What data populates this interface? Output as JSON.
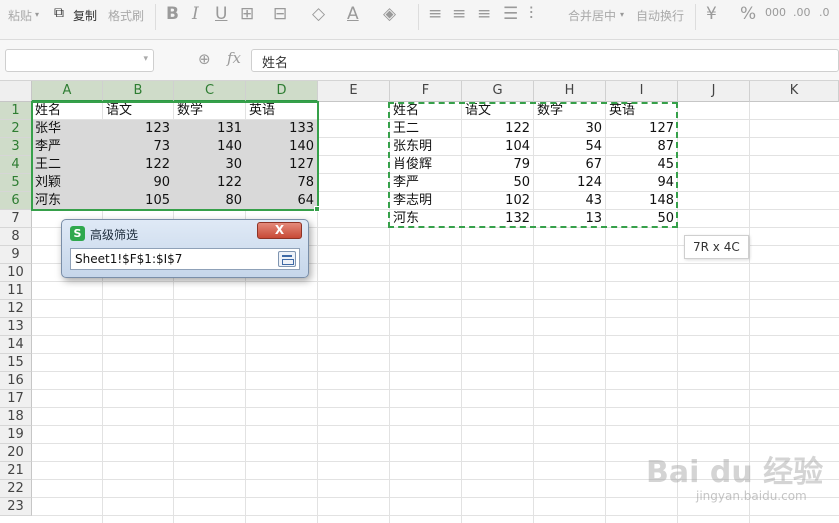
{
  "toolbar": {
    "paste_label": "粘贴",
    "copy_label": "复制",
    "format_painter_label": "格式刷",
    "bold_label": "B",
    "italic_label": "I",
    "underline_label": "U",
    "merge_center_label": "合并居中",
    "wrap_text_label": "自动换行",
    "percent_label": "%"
  },
  "formula_bar": {
    "fx_label": "fx",
    "content": "姓名"
  },
  "grid": {
    "columns": [
      "A",
      "B",
      "C",
      "D",
      "E",
      "F",
      "G",
      "H",
      "I",
      "J",
      "K"
    ],
    "rows": [
      "1",
      "2",
      "3",
      "4",
      "5",
      "6",
      "7",
      "8",
      "9",
      "10",
      "11",
      "12",
      "13",
      "14",
      "15",
      "16",
      "17",
      "18",
      "19",
      "20",
      "21",
      "22",
      "23"
    ]
  },
  "table_left": [
    [
      "姓名",
      "语文",
      "数学",
      "英语"
    ],
    [
      "张华",
      "123",
      "131",
      "133"
    ],
    [
      "李严",
      "73",
      "140",
      "140"
    ],
    [
      "王二",
      "122",
      "30",
      "127"
    ],
    [
      "刘颖",
      "90",
      "122",
      "78"
    ],
    [
      "河东",
      "105",
      "80",
      "64"
    ]
  ],
  "table_right": [
    [
      "姓名",
      "语文",
      "数学",
      "英语"
    ],
    [
      "王二",
      "122",
      "30",
      "127"
    ],
    [
      "张东明",
      "104",
      "54",
      "87"
    ],
    [
      "肖俊辉",
      "79",
      "67",
      "45"
    ],
    [
      "李严",
      "50",
      "124",
      "94"
    ],
    [
      "李志明",
      "102",
      "43",
      "148"
    ],
    [
      "河东",
      "132",
      "13",
      "50"
    ]
  ],
  "selection_size_tip": "7R x 4C",
  "dialog": {
    "title": "高级筛选",
    "logo_letter": "S",
    "close_label": "X",
    "range_value": "Sheet1!$F$1:$I$7"
  },
  "watermark": {
    "main": "Bai du 经验",
    "sub": "jingyan.baidu.com"
  },
  "colors": {
    "accent_green": "#36a04a",
    "selected_header_bg": "#cfdcc9",
    "selected_range_fill": "#d9d9d9"
  }
}
